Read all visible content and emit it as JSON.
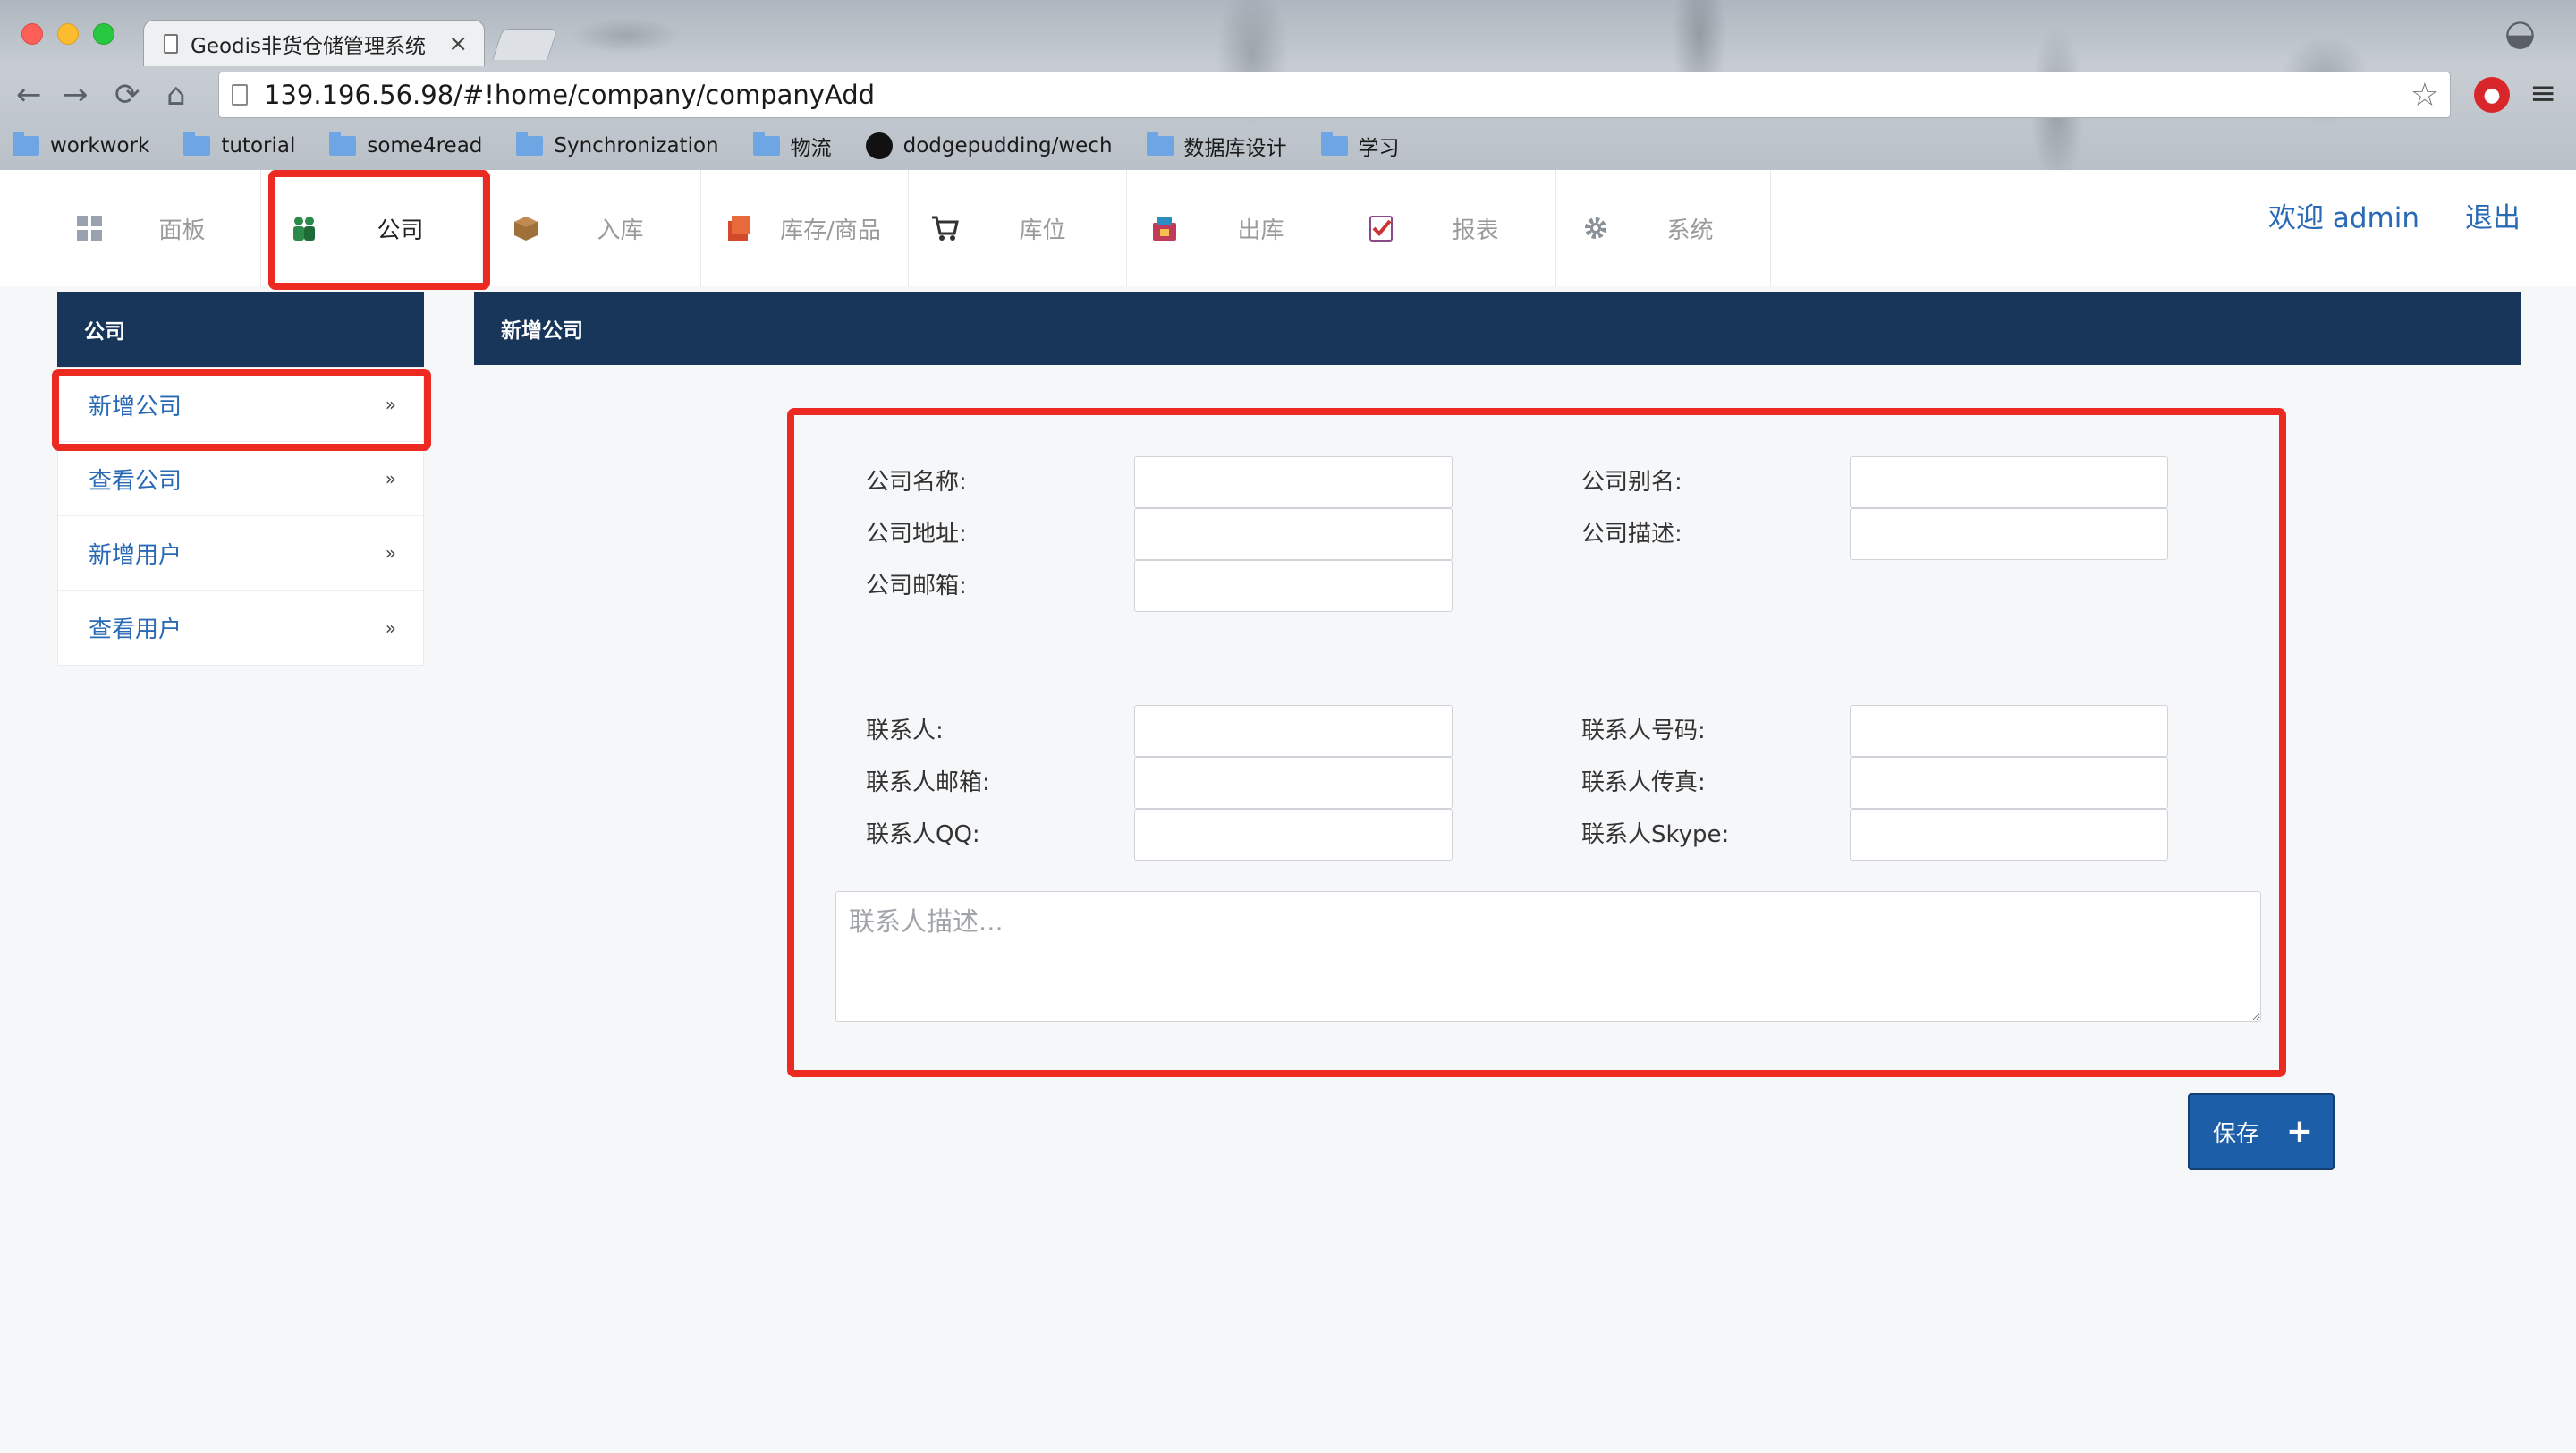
{
  "browser": {
    "tab_title": "Geodis非货仓储管理系统",
    "tab_close": "×",
    "url": "139.196.56.98/#!home/company/companyAdd",
    "back": "←",
    "forward": "→",
    "reload": "⟳",
    "home": "⌂",
    "star": "☆",
    "menu": "≡",
    "bookmarks": [
      {
        "label": "workwork",
        "icon": "folder-icon"
      },
      {
        "label": "tutorial",
        "icon": "folder-icon"
      },
      {
        "label": "some4read",
        "icon": "folder-icon"
      },
      {
        "label": "Synchronization",
        "icon": "folder-icon"
      },
      {
        "label": "物流",
        "icon": "folder-icon"
      },
      {
        "label": "dodgepudding/wech",
        "icon": "github-icon"
      },
      {
        "label": "数据库设计",
        "icon": "folder-icon"
      },
      {
        "label": "学习",
        "icon": "folder-icon"
      }
    ]
  },
  "header": {
    "nav": [
      {
        "label": "面板",
        "icon": "dashboard-icon",
        "color": "#9aa3ad"
      },
      {
        "label": "公司",
        "icon": "people-icon",
        "color": "#2b8a4a"
      },
      {
        "label": "入库",
        "icon": "box-icon",
        "color": "#a0703a"
      },
      {
        "label": "库存/商品",
        "icon": "stock-icon",
        "color": "#d24a2a"
      },
      {
        "label": "库位",
        "icon": "cart-icon",
        "color": "#333333"
      },
      {
        "label": "出库",
        "icon": "outbound-icon",
        "color": "#c23a5a"
      },
      {
        "label": "报表",
        "icon": "report-icon",
        "color": "#cc3333"
      },
      {
        "label": "系统",
        "icon": "gear-icon",
        "color": "#8a9098"
      }
    ],
    "welcome": "欢迎 admin",
    "logout": "退出"
  },
  "sidebar": {
    "title": "公司",
    "items": [
      {
        "label": "新增公司"
      },
      {
        "label": "查看公司"
      },
      {
        "label": "新增用户"
      },
      {
        "label": "查看用户"
      }
    ],
    "arrow": "»"
  },
  "main": {
    "title": "新增公司",
    "fields": {
      "company_name": {
        "label": "公司名称:",
        "value": ""
      },
      "company_alias": {
        "label": "公司别名:",
        "value": ""
      },
      "company_address": {
        "label": "公司地址:",
        "value": ""
      },
      "company_description": {
        "label": "公司描述:",
        "value": ""
      },
      "company_email": {
        "label": "公司邮箱:",
        "value": ""
      },
      "contact_person": {
        "label": "联系人:",
        "value": ""
      },
      "contact_phone": {
        "label": "联系人号码:",
        "value": ""
      },
      "contact_email": {
        "label": "联系人邮箱:",
        "value": ""
      },
      "contact_fax": {
        "label": "联系人传真:",
        "value": ""
      },
      "contact_qq": {
        "label": "联系人QQ:",
        "value": ""
      },
      "contact_skype": {
        "label": "联系人Skype:",
        "value": ""
      }
    },
    "description_placeholder": "联系人描述...",
    "save_label": "保存",
    "save_icon": "+"
  },
  "colors": {
    "brand_dark": "#17365a",
    "link": "#2a6ab5",
    "highlight": "#ec2a22",
    "save_button": "#1d5ea8"
  }
}
